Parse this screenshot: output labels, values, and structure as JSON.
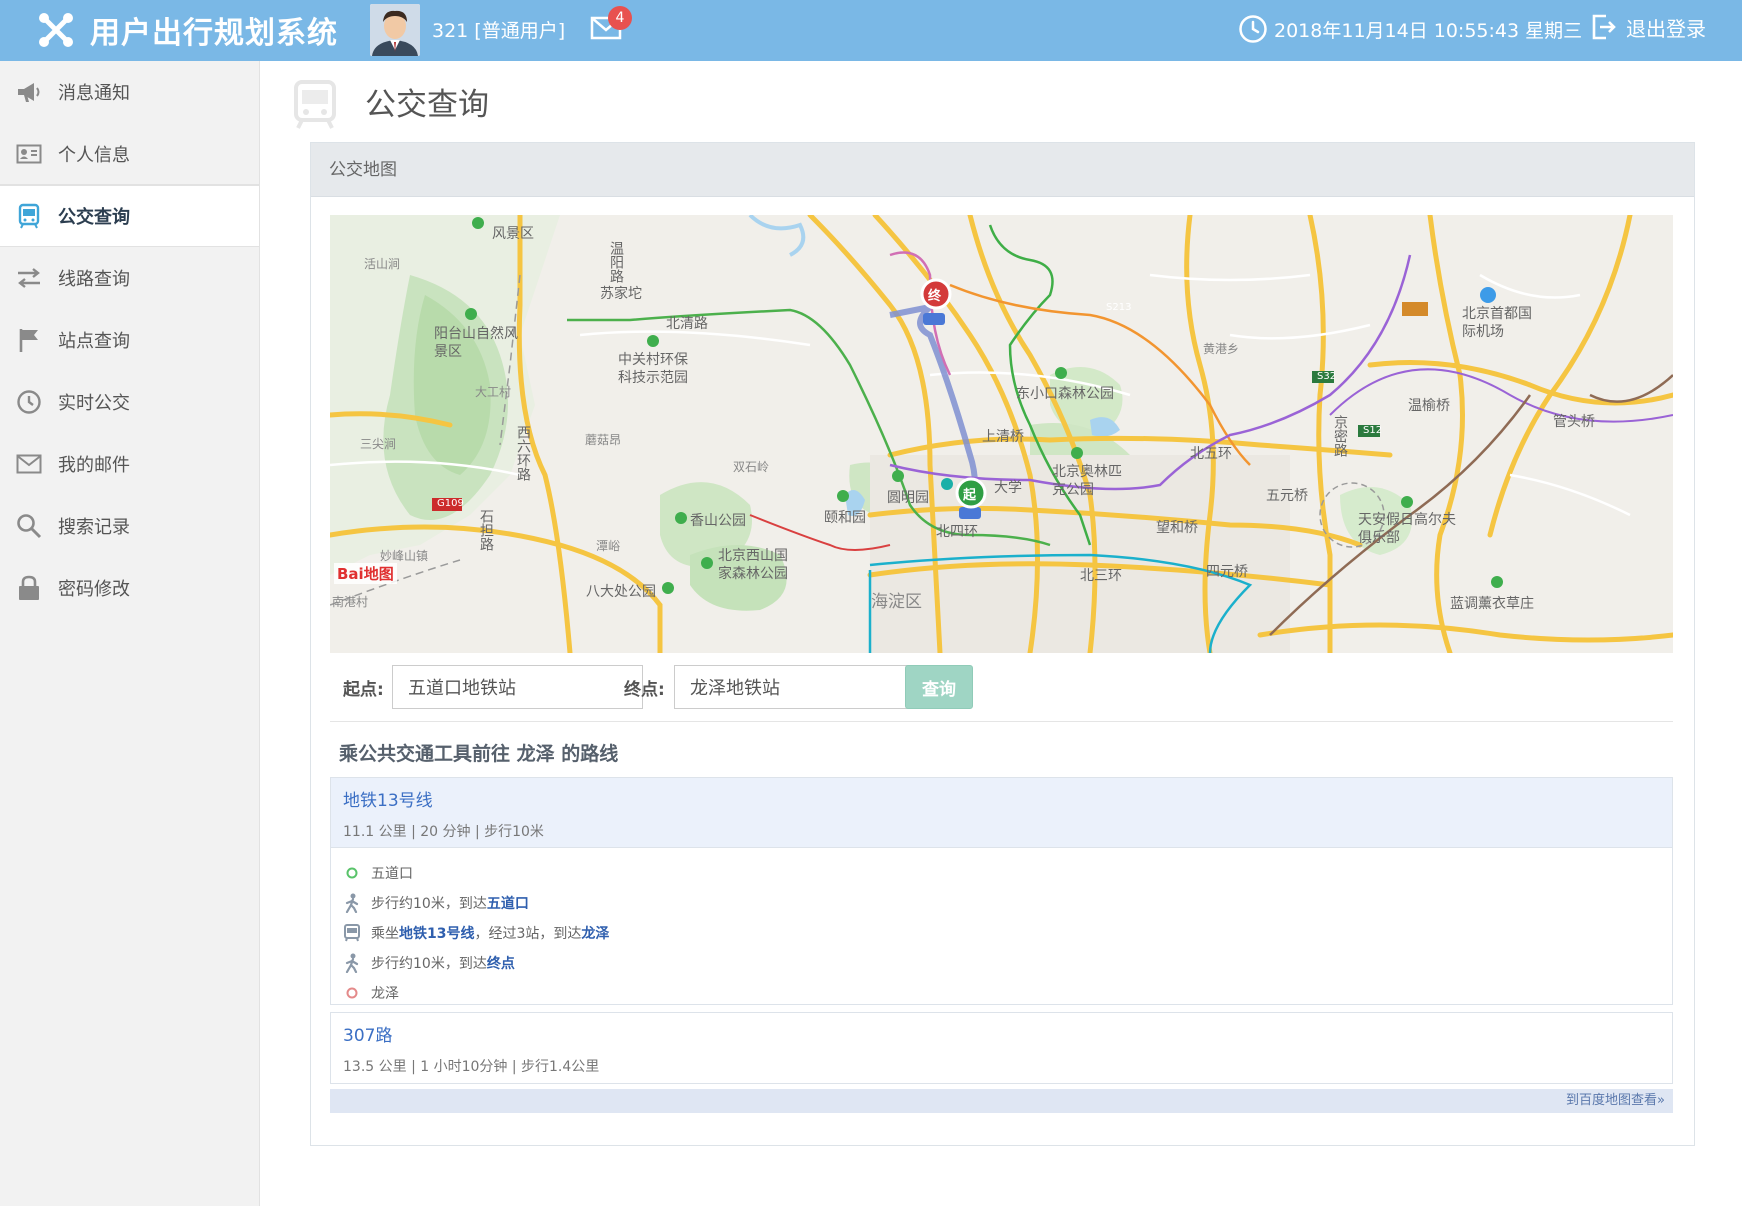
{
  "app": {
    "title": "用户出行规划系统"
  },
  "user": {
    "label": "321 [普通用户]",
    "mail_count": "4"
  },
  "header": {
    "datetime": "2018年11月14日 10:55:43 星期三",
    "logout_label": "退出登录"
  },
  "sidebar": {
    "items": [
      {
        "label": "消息通知",
        "icon": "megaphone-icon"
      },
      {
        "label": "个人信息",
        "icon": "id-card-icon"
      },
      {
        "label": "公交查询",
        "icon": "bus-icon",
        "active": true
      },
      {
        "label": "线路查询",
        "icon": "exchange-arrows-icon"
      },
      {
        "label": "站点查询",
        "icon": "flag-icon"
      },
      {
        "label": "实时公交",
        "icon": "clock-icon"
      },
      {
        "label": "我的邮件",
        "icon": "envelope-icon"
      },
      {
        "label": "搜索记录",
        "icon": "search-icon"
      },
      {
        "label": "密码修改",
        "icon": "lock-icon"
      }
    ]
  },
  "page": {
    "title": "公交查询"
  },
  "panel": {
    "title": "公交地图"
  },
  "map": {
    "labels": {
      "scenic_top": "风景区",
      "huoshan": "活山涧",
      "wenyang": "温阳路",
      "sujiatuo": "苏家坨",
      "beiqing": "北清路",
      "yangtai": "阳台山自然风景区",
      "zhongguancun": "中关村环保科技示范园",
      "dagong": "大工村",
      "sanjian": "三尖涧",
      "xiliuhuan": "西六环路",
      "mogu": "蘑菇昂",
      "shuangshi": "双石岭",
      "xiangshan": "香山公园",
      "yiheyuan": "颐和园",
      "yuanmingyuan": "圆明园",
      "g109": "G109",
      "shijinglu": "石担路",
      "miaofeng": "妙峰山镇",
      "tanqi": "潭峪",
      "xishan": "北京西山国家森林公园",
      "badachu": "八大处公园",
      "haidian": "海淀区",
      "nangang": "南港村",
      "shangqing": "上清桥",
      "dongxiaokou": "东小口森林公园",
      "huanggang": "黄港乡",
      "s213": "S213",
      "airport": "北京首都国际机场",
      "s32": "S32",
      "s12": "S12",
      "wenyu": "温榆桥",
      "guantou": "管头桥",
      "jingmi": "京密路",
      "beiwu": "北五环",
      "olympic": "北京奥林匹克公园",
      "daxue": "大学",
      "beisihuan": "北四环",
      "wangheqiao": "望和桥",
      "wuyuanqiao": "五元桥",
      "beisan": "北三环",
      "siyuanqiao": "四元桥",
      "tianan": "天安假日高尔夫俱乐部",
      "landiao": "蓝调薰衣草庄",
      "marker_end": "终",
      "marker_start": "起",
      "baidu": "Bai地图"
    }
  },
  "form": {
    "start_label": "起点:",
    "start_value": "五道口地铁站",
    "end_label": "终点:",
    "end_value": "龙泽地铁站",
    "query_label": "查询"
  },
  "results": {
    "heading": "乘公共交通工具前往 龙泽 的路线",
    "routes": [
      {
        "name": "地铁13号线",
        "meta": "11.1 公里 | 20 分钟 | 步行10米",
        "steps": {
          "s0": "五道口",
          "s1_pre": "步行约10米，到达",
          "s1_b": "五道口",
          "s2_pre": "乘坐",
          "s2_b": "地铁13号线",
          "s2_mid": "，经过3站，到达",
          "s2_b2": "龙泽",
          "s3_pre": "步行约10米，到达",
          "s3_b": "终点",
          "s4": "龙泽"
        }
      },
      {
        "name": "307路",
        "meta": "13.5 公里 | 1 小时10分钟 | 步行1.4公里"
      }
    ],
    "more_link": "到百度地图查看»"
  },
  "colors": {
    "topbar": "#7ab8e6",
    "accent_link": "#3b6fc4",
    "badge": "#e8514f",
    "query_btn": "#9fd5c4"
  }
}
